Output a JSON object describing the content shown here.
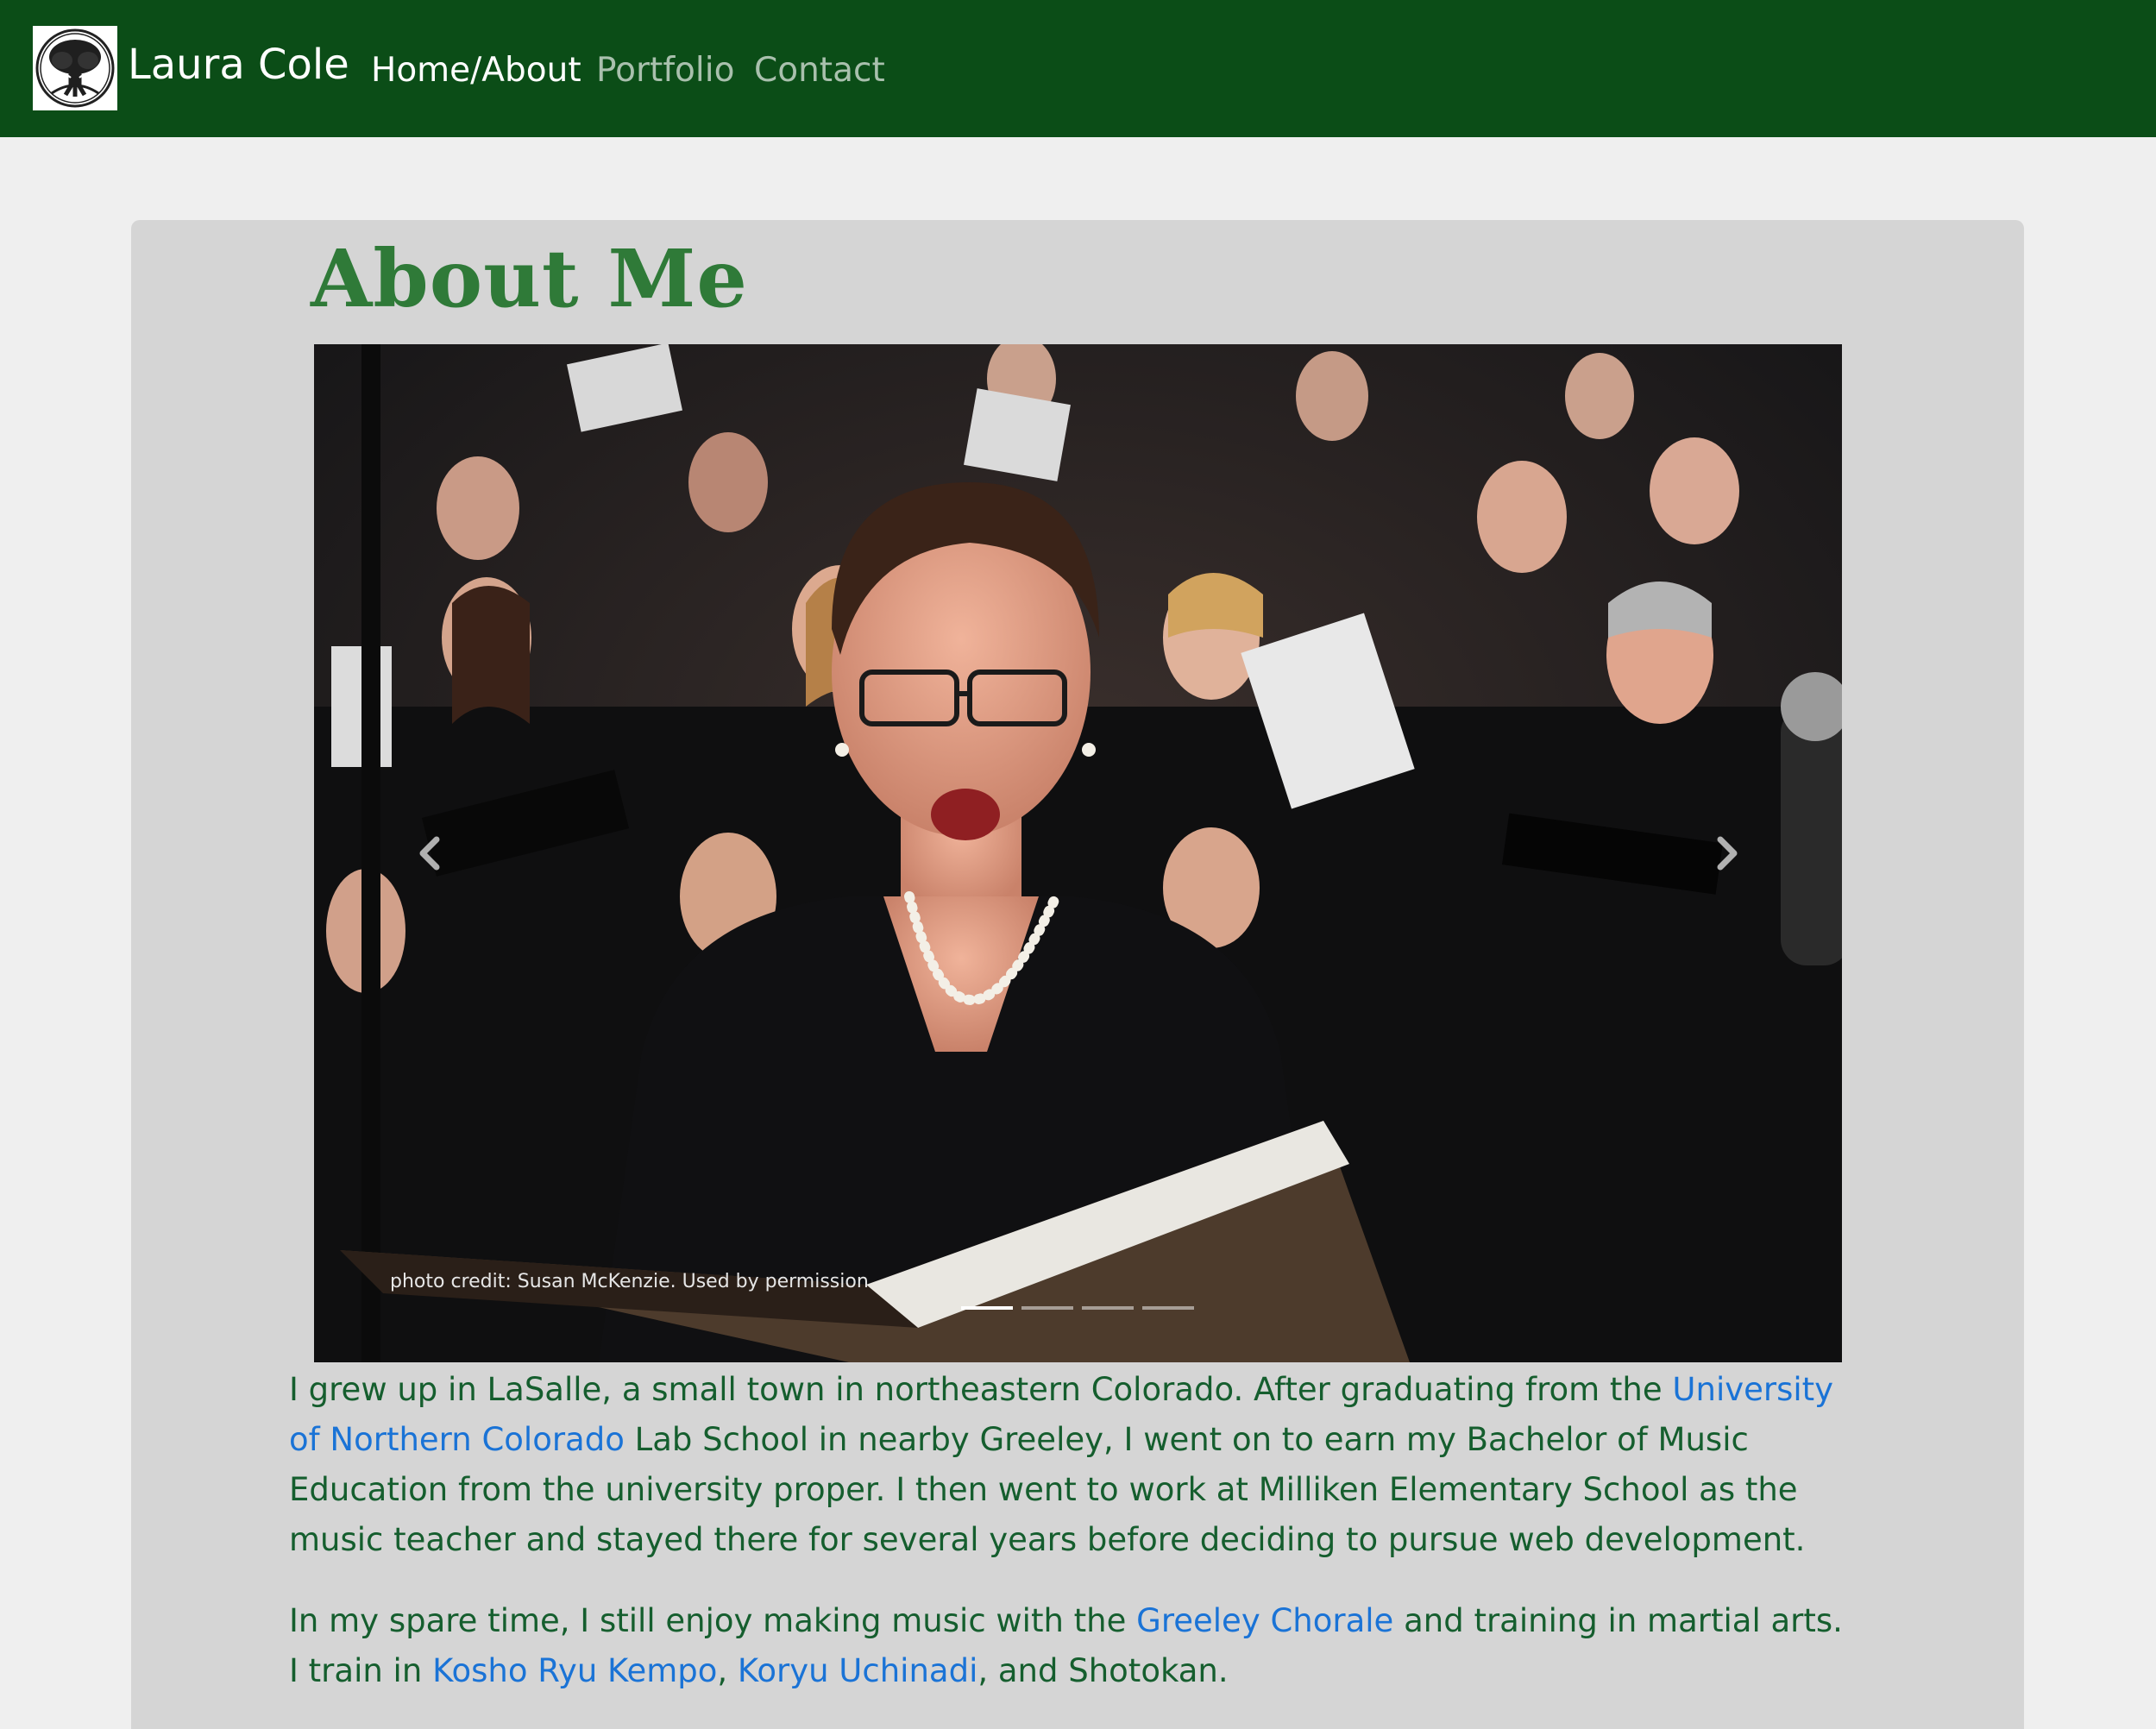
{
  "colors": {
    "navbar": "#0b4d17",
    "page_background": "#efefef",
    "card_background": "#d5d5d5",
    "title": "#2f7a38",
    "body_text": "#155e2e",
    "link": "#1a73d6"
  },
  "nav": {
    "logo_icon": "tree-of-life-icon",
    "brand": "Laura Cole",
    "links": [
      {
        "label": "Home/About",
        "active": true
      },
      {
        "label": "Portfolio",
        "active": false
      },
      {
        "label": "Contact",
        "active": false
      }
    ]
  },
  "main": {
    "title": "About Me",
    "carousel": {
      "caption": "photo credit: Susan McKenzie. Used by permission",
      "slide_count": 4,
      "active_slide": 1,
      "prev_icon": "chevron-left-icon",
      "next_icon": "chevron-right-icon"
    },
    "paragraph1": {
      "t1": "I grew up in LaSalle, a small town in northeastern Colorado. After graduating from the ",
      "link1": "University of Northern Colorado",
      "t2": " Lab School in nearby Greeley, I went on to earn my Bachelor of Music Education from the university proper. I then went to work at Milliken Elementary School as the music teacher and stayed there for several years before deciding to pursue web development."
    },
    "paragraph2": {
      "t1": "In my spare time, I still enjoy making music with the ",
      "link1": "Greeley Chorale",
      "t2": " and training in martial arts. I train in ",
      "link2": "Kosho Ryu Kempo",
      "t3": ", ",
      "link3": "Koryu Uchinadi",
      "t4": ", and Shotokan."
    }
  }
}
